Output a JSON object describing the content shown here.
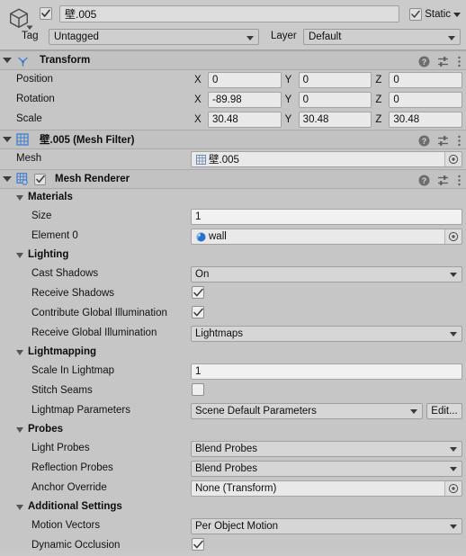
{
  "header": {
    "gameobject_icon": "cube-icon",
    "active_checkbox": true,
    "name": "壁.005",
    "static_label": "Static",
    "static_checkbox": true,
    "tag_label": "Tag",
    "tag_value": "Untagged",
    "layer_label": "Layer",
    "layer_value": "Default"
  },
  "components": [
    {
      "title": "Transform",
      "icon": "transform-icon",
      "expanded": true,
      "rows": [
        {
          "label": "Position",
          "x": "0",
          "y": "0",
          "z": "0"
        },
        {
          "label": "Rotation",
          "x": "-89.98",
          "y": "0",
          "z": "0"
        },
        {
          "label": "Scale",
          "x": "30.48",
          "y": "30.48",
          "z": "30.48"
        }
      ],
      "axis_labels": {
        "x": "X",
        "y": "Y",
        "z": "Z"
      }
    },
    {
      "title": "壁.005 (Mesh Filter)",
      "icon": "mesh-filter-icon",
      "expanded": true,
      "mesh_label": "Mesh",
      "mesh_value": "壁.005"
    },
    {
      "title": "Mesh Renderer",
      "icon": "mesh-renderer-icon",
      "expanded": true,
      "enabled": true
    }
  ],
  "materials": {
    "group_label": "Materials",
    "size_label": "Size",
    "size_value": "1",
    "element0_label": "Element 0",
    "element0_value": "wall"
  },
  "lighting": {
    "group_label": "Lighting",
    "cast_shadows_label": "Cast Shadows",
    "cast_shadows_value": "On",
    "receive_shadows_label": "Receive Shadows",
    "receive_shadows_checked": true,
    "contribute_gi_label": "Contribute Global Illumination",
    "contribute_gi_checked": true,
    "receive_gi_label": "Receive Global Illumination",
    "receive_gi_value": "Lightmaps"
  },
  "lightmapping": {
    "group_label": "Lightmapping",
    "scale_in_lightmap_label": "Scale In Lightmap",
    "scale_in_lightmap_value": "1",
    "stitch_seams_label": "Stitch Seams",
    "stitch_seams_checked": false,
    "lightmap_parameters_label": "Lightmap Parameters",
    "lightmap_parameters_value": "Scene Default Parameters",
    "edit_button_label": "Edit..."
  },
  "probes": {
    "group_label": "Probes",
    "light_probes_label": "Light Probes",
    "light_probes_value": "Blend Probes",
    "reflection_probes_label": "Reflection Probes",
    "reflection_probes_value": "Blend Probes",
    "anchor_override_label": "Anchor Override",
    "anchor_override_value": "None (Transform)"
  },
  "additional_settings": {
    "group_label": "Additional Settings",
    "motion_vectors_label": "Motion Vectors",
    "motion_vectors_value": "Per Object Motion",
    "dynamic_occlusion_label": "Dynamic Occlusion",
    "dynamic_occlusion_checked": true
  },
  "colors": {
    "background": "#c8c8c8",
    "component_header": "#c2c2c2",
    "field_background": "#e9e9e9",
    "unity_blue": "#3d7fd1",
    "text": "#111111"
  },
  "icons": {
    "help": "help-icon",
    "preset": "preset-icon",
    "menu": "kebab-menu-icon",
    "picker": "object-picker-icon"
  }
}
